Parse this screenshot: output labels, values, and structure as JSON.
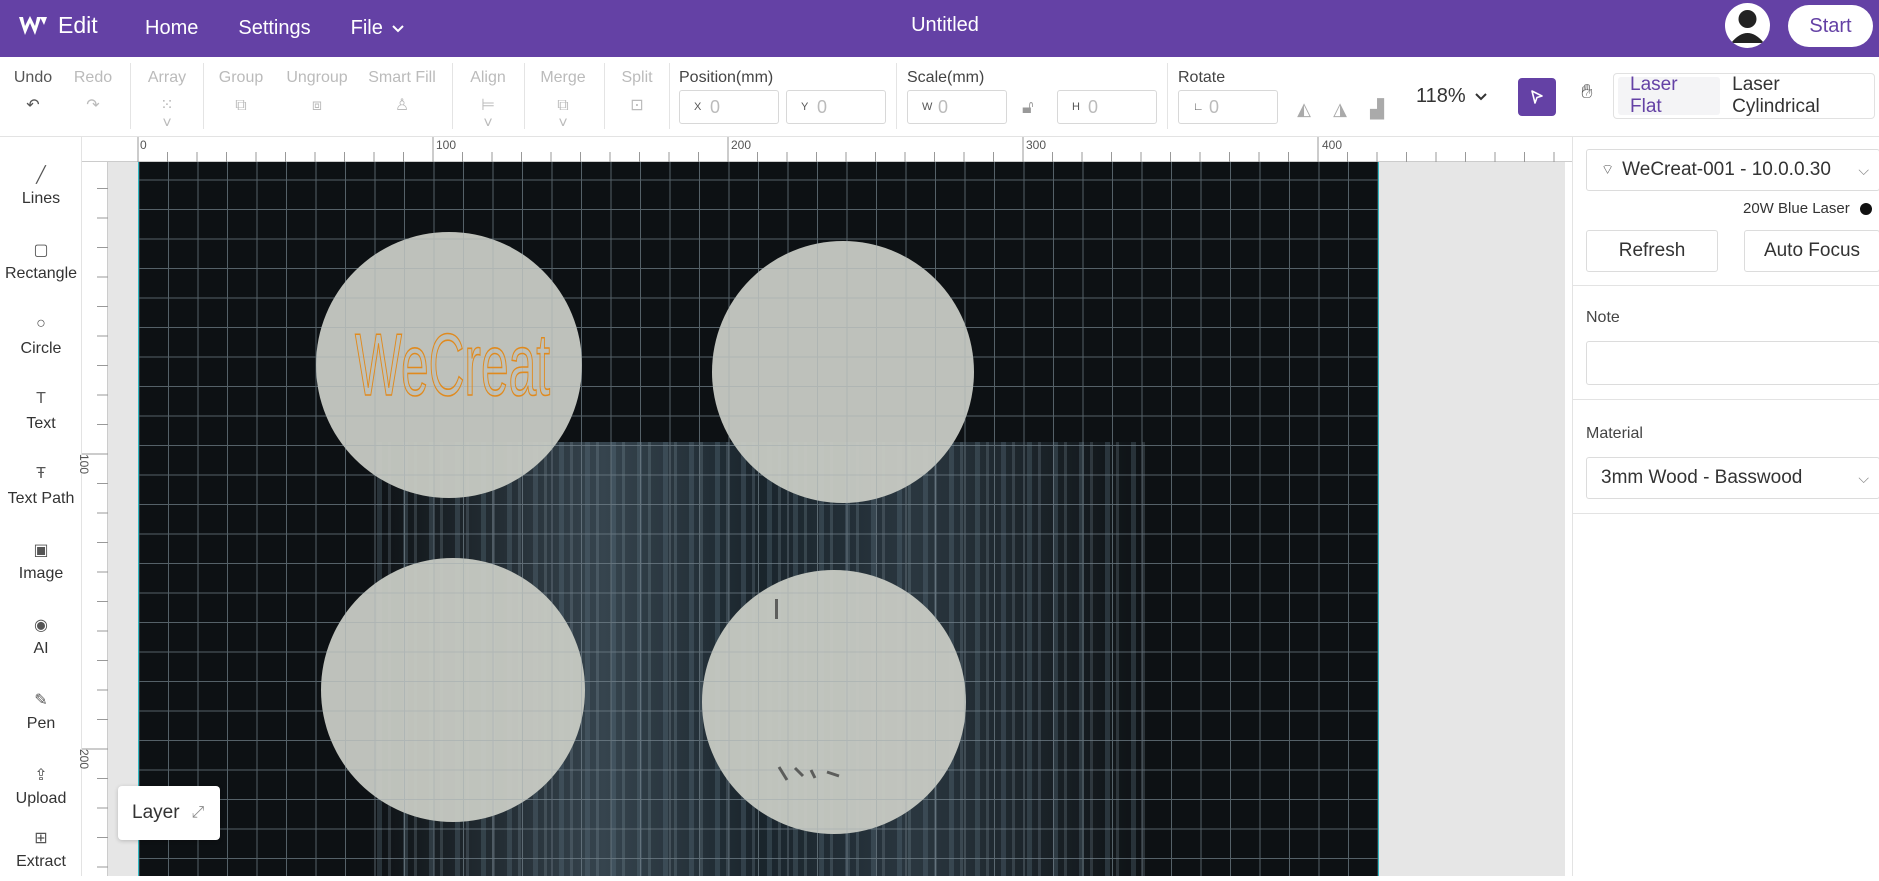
{
  "header": {
    "app_name": "Edit",
    "nav": [
      "Home",
      "Settings",
      "File"
    ],
    "doc_title": "Untitled",
    "start_label": "Start"
  },
  "toolbar": {
    "undo": "Undo",
    "redo": "Redo",
    "array": "Array",
    "group": "Group",
    "ungroup": "Ungroup",
    "smart_fill": "Smart Fill",
    "align": "Align",
    "merge": "Merge",
    "split": "Split",
    "position_label": "Position(mm)",
    "x_label": "X",
    "x_value": "0",
    "y_label": "Y",
    "y_value": "0",
    "scale_label": "Scale(mm)",
    "w_label": "W",
    "w_value": "0",
    "h_label": "H",
    "h_value": "0",
    "rotate_label": "Rotate",
    "rotate_value": "0",
    "zoom": "118%",
    "mode_flat": "Laser Flat",
    "mode_cyl": "Laser Cylindrical"
  },
  "left_tools": [
    "Lines",
    "Rectangle",
    "Circle",
    "Text",
    "Text Path",
    "Image",
    "AI",
    "Pen",
    "Upload",
    "Extract"
  ],
  "ruler": {
    "top": [
      "0",
      "100",
      "200",
      "300",
      "400"
    ],
    "left": [
      "100",
      "200"
    ]
  },
  "canvas": {
    "engraving_text": "WeCreat",
    "text_color": "#e08a1e"
  },
  "layer_label": "Layer",
  "right_panel": {
    "device": "WeCreat-001 - 10.0.0.30",
    "laser": "20W Blue Laser",
    "refresh": "Refresh",
    "auto_focus": "Auto Focus",
    "note_label": "Note",
    "note_value": "",
    "material_label": "Material",
    "material_value": "3mm Wood - Basswood"
  },
  "colors": {
    "brand": "#6441a5",
    "canvas_bg": "#0d1114",
    "grid": "#4a5a66"
  }
}
